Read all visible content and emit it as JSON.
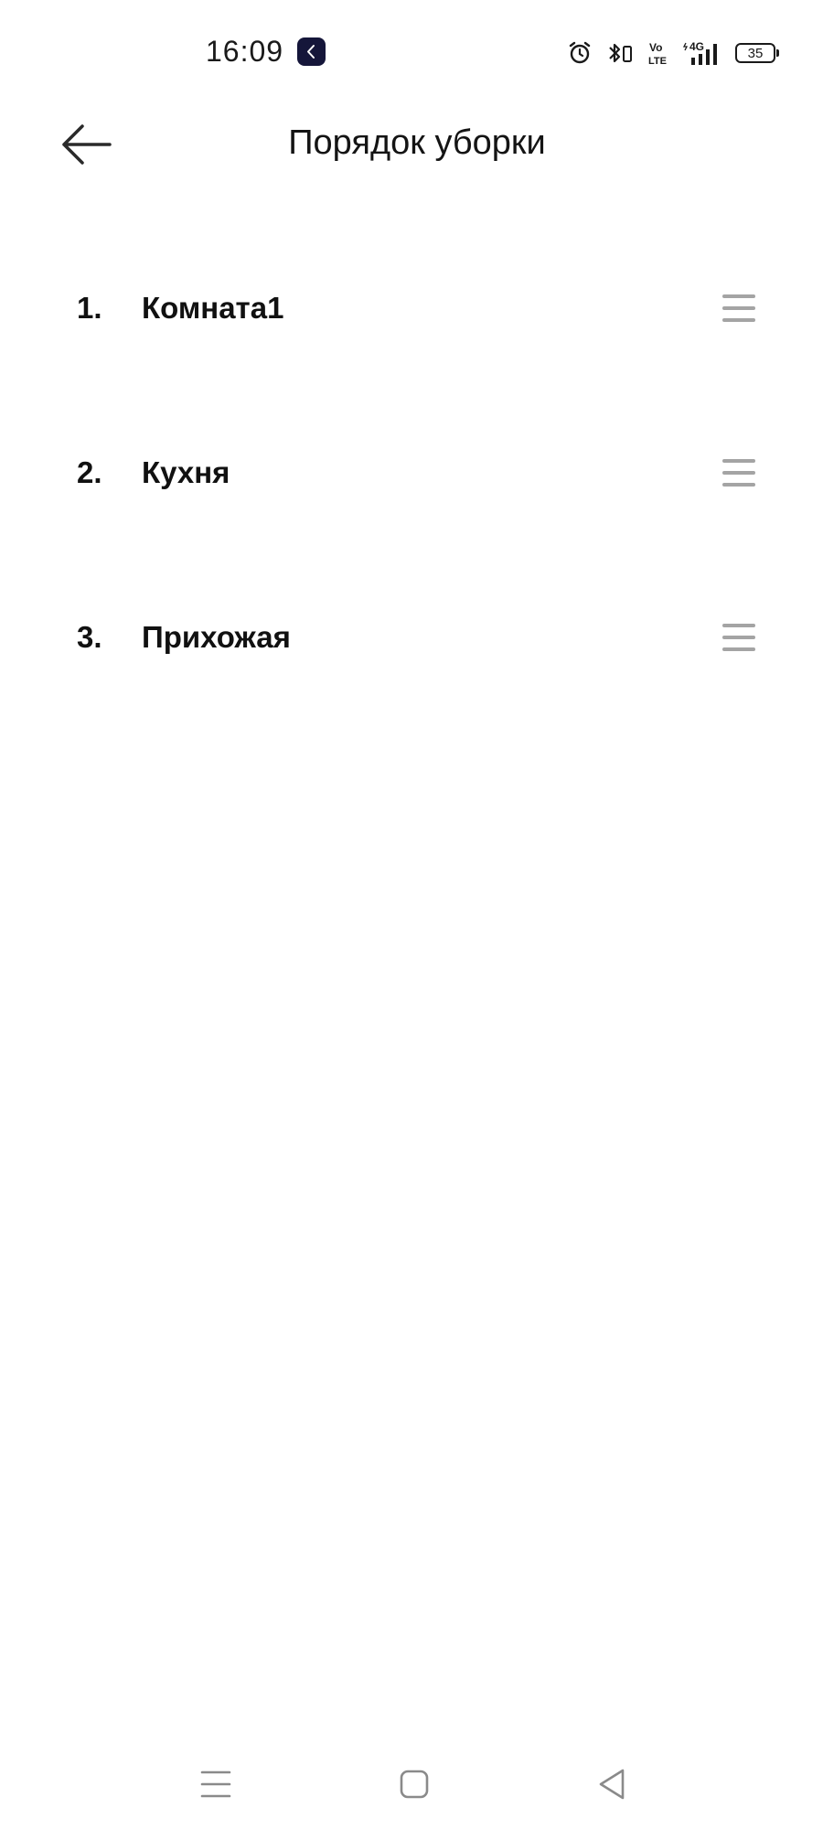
{
  "status_bar": {
    "time": "16:09",
    "battery_level": "35",
    "network": "4G",
    "volte_top": "Vo",
    "volte_bottom": "LTE",
    "icons": [
      "notification-app-icon",
      "alarm-icon",
      "bluetooth-icon",
      "volte-icon",
      "signal-icon",
      "battery-icon"
    ]
  },
  "header": {
    "title": "Порядок уборки",
    "back_icon": "arrow-left-icon"
  },
  "rooms": [
    {
      "number": "1.",
      "name": "Комната1"
    },
    {
      "number": "2.",
      "name": "Кухня"
    },
    {
      "number": "3.",
      "name": "Прихожая"
    }
  ],
  "nav_bar": {
    "icons": [
      "menu-icon",
      "home-icon",
      "back-triangle-icon"
    ]
  },
  "colors": {
    "background": "#ffffff",
    "text": "#111111",
    "handle": "#a4a4a4"
  }
}
